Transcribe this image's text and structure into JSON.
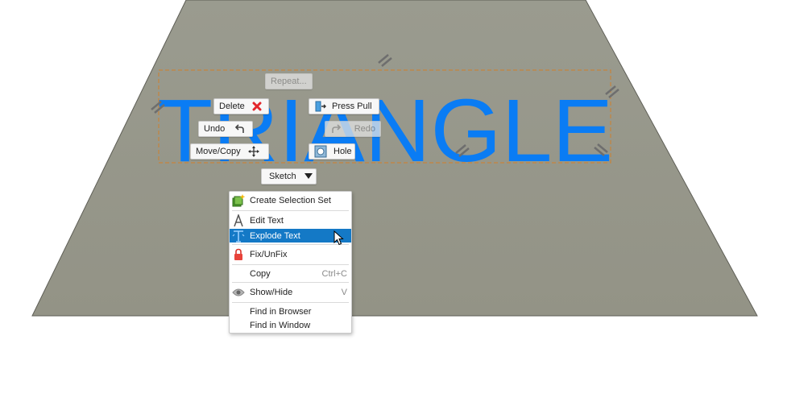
{
  "model": {
    "text": "TRIANGLE",
    "text_color": "#0a7cf4",
    "surface_color": "#999a8e",
    "selection_color": "#d2843e"
  },
  "marking_menu": {
    "repeat": "Repeat...",
    "delete": "Delete",
    "press_pull": "Press Pull",
    "undo": "Undo",
    "redo": "Redo",
    "move_copy": "Move/Copy",
    "hole": "Hole",
    "sketch": "Sketch"
  },
  "context_menu": {
    "items": [
      {
        "label": "Create Selection Set",
        "icon": "selection-set-icon",
        "shortcut": ""
      },
      {
        "label": "Edit Text",
        "icon": "text-a-icon",
        "shortcut": ""
      },
      {
        "label": "Explode Text",
        "icon": "explode-text-icon",
        "shortcut": "",
        "highlighted": true
      },
      {
        "label": "Fix/UnFix",
        "icon": "lock-icon",
        "shortcut": ""
      },
      {
        "label": "Copy",
        "icon": "",
        "shortcut": "Ctrl+C"
      },
      {
        "label": "Show/Hide",
        "icon": "eye-icon",
        "shortcut": "V"
      },
      {
        "label": "Find in Browser",
        "icon": "",
        "shortcut": ""
      },
      {
        "label": "Find in Window",
        "icon": "",
        "shortcut": ""
      }
    ]
  }
}
